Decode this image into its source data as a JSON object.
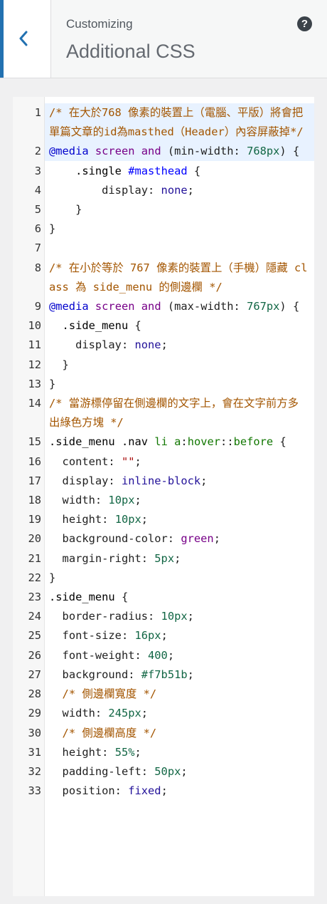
{
  "header": {
    "subtitle": "Customizing",
    "title": "Additional CSS",
    "back_label": "Back",
    "help_label": "?"
  },
  "editor": {
    "lines": [
      {
        "n": "1",
        "tokens": [
          [
            "cm",
            "/* 在大於768 像素的裝置上（電腦、平版）將會把單篇文章的id為masthed（Header）內容屏蔽掉*/"
          ]
        ]
      },
      {
        "n": "2",
        "tokens": [
          [
            "at",
            "@media"
          ],
          [
            "",
            " "
          ],
          [
            "kw",
            "screen"
          ],
          [
            "",
            " "
          ],
          [
            "kw",
            "and"
          ],
          [
            "",
            " (min-width: "
          ],
          [
            "num",
            "768px"
          ],
          [
            "",
            ") {"
          ]
        ]
      },
      {
        "n": "3",
        "tokens": [
          [
            "",
            "    "
          ],
          [
            "cls",
            ".single"
          ],
          [
            "",
            " "
          ],
          [
            "id",
            "#masthead"
          ],
          [
            "",
            " {"
          ]
        ]
      },
      {
        "n": "4",
        "tokens": [
          [
            "",
            "        display: "
          ],
          [
            "val",
            "none"
          ],
          [
            "",
            ";"
          ]
        ]
      },
      {
        "n": "5",
        "tokens": [
          [
            "",
            "    }"
          ]
        ]
      },
      {
        "n": "6",
        "tokens": [
          [
            "",
            "}"
          ]
        ]
      },
      {
        "n": "7",
        "tokens": [
          [
            "",
            " "
          ]
        ]
      },
      {
        "n": "8",
        "tokens": [
          [
            "cm",
            "/* 在小於等於 767 像素的裝置上（手機）隱藏 class 為 side_menu 的側邊欄 */"
          ]
        ]
      },
      {
        "n": "9",
        "tokens": [
          [
            "at",
            "@media"
          ],
          [
            "",
            " "
          ],
          [
            "kw",
            "screen"
          ],
          [
            "",
            " "
          ],
          [
            "kw",
            "and"
          ],
          [
            "",
            " (max-width: "
          ],
          [
            "num",
            "767px"
          ],
          [
            "",
            ") {"
          ]
        ]
      },
      {
        "n": "10",
        "tokens": [
          [
            "",
            "  "
          ],
          [
            "cls",
            ".side_menu"
          ],
          [
            "",
            " {"
          ]
        ]
      },
      {
        "n": "11",
        "tokens": [
          [
            "",
            "    display: "
          ],
          [
            "val",
            "none"
          ],
          [
            "",
            ";"
          ]
        ]
      },
      {
        "n": "12",
        "tokens": [
          [
            "",
            "  }"
          ]
        ]
      },
      {
        "n": "13",
        "tokens": [
          [
            "",
            "}"
          ]
        ]
      },
      {
        "n": "14",
        "tokens": [
          [
            "cm",
            "/* 當游標停留在側邊欄的文字上，會在文字前方多出綠色方塊 */"
          ]
        ]
      },
      {
        "n": "15",
        "tokens": [
          [
            "cls",
            ".side_menu"
          ],
          [
            "",
            " "
          ],
          [
            "cls",
            ".nav"
          ],
          [
            "",
            " "
          ],
          [
            "tag",
            "li"
          ],
          [
            "",
            " "
          ],
          [
            "tag",
            "a"
          ],
          [
            "",
            ":"
          ],
          [
            "tag",
            "hover"
          ],
          [
            "",
            "::"
          ],
          [
            "tag",
            "before"
          ],
          [
            "",
            " {"
          ]
        ]
      },
      {
        "n": "16",
        "tokens": [
          [
            "",
            "  content: "
          ],
          [
            "str",
            "\"\""
          ],
          [
            "",
            ";"
          ]
        ]
      },
      {
        "n": "17",
        "tokens": [
          [
            "",
            "  display: "
          ],
          [
            "val",
            "inline-block"
          ],
          [
            "",
            ";"
          ]
        ]
      },
      {
        "n": "18",
        "tokens": [
          [
            "",
            "  width: "
          ],
          [
            "num",
            "10px"
          ],
          [
            "",
            ";"
          ]
        ]
      },
      {
        "n": "19",
        "tokens": [
          [
            "",
            "  height: "
          ],
          [
            "num",
            "10px"
          ],
          [
            "",
            ";"
          ]
        ]
      },
      {
        "n": "20",
        "tokens": [
          [
            "",
            "  background-color: "
          ],
          [
            "vr",
            "green"
          ],
          [
            "",
            ";"
          ]
        ]
      },
      {
        "n": "21",
        "tokens": [
          [
            "",
            "  margin-right: "
          ],
          [
            "num",
            "5px"
          ],
          [
            "",
            ";"
          ]
        ]
      },
      {
        "n": "22",
        "tokens": [
          [
            "",
            "}"
          ]
        ]
      },
      {
        "n": "23",
        "tokens": [
          [
            "cls",
            ".side_menu"
          ],
          [
            "",
            " {"
          ]
        ]
      },
      {
        "n": "24",
        "tokens": [
          [
            "",
            "  border-radius: "
          ],
          [
            "num",
            "10px"
          ],
          [
            "",
            ";"
          ]
        ]
      },
      {
        "n": "25",
        "tokens": [
          [
            "",
            "  font-size: "
          ],
          [
            "num",
            "16px"
          ],
          [
            "",
            ";"
          ]
        ]
      },
      {
        "n": "26",
        "tokens": [
          [
            "",
            "  font-weight: "
          ],
          [
            "num",
            "400"
          ],
          [
            "",
            ";"
          ]
        ]
      },
      {
        "n": "27",
        "tokens": [
          [
            "",
            "  background: "
          ],
          [
            "num",
            "#f7b51b"
          ],
          [
            "",
            ";"
          ]
        ]
      },
      {
        "n": "28",
        "tokens": [
          [
            "",
            "  "
          ],
          [
            "cm",
            "/* 側邊欄寬度 */"
          ]
        ]
      },
      {
        "n": "29",
        "tokens": [
          [
            "",
            "  width: "
          ],
          [
            "num",
            "245px"
          ],
          [
            "",
            ";"
          ]
        ]
      },
      {
        "n": "30",
        "tokens": [
          [
            "",
            "  "
          ],
          [
            "cm",
            "/* 側邊欄高度 */"
          ]
        ]
      },
      {
        "n": "31",
        "tokens": [
          [
            "",
            "  height: "
          ],
          [
            "num",
            "55%"
          ],
          [
            "",
            ";"
          ]
        ]
      },
      {
        "n": "32",
        "tokens": [
          [
            "",
            "  padding-left: "
          ],
          [
            "num",
            "50px"
          ],
          [
            "",
            ";"
          ]
        ]
      },
      {
        "n": "33",
        "tokens": [
          [
            "",
            "  position: "
          ],
          [
            "val",
            "fixed"
          ],
          [
            "",
            ";"
          ]
        ]
      }
    ]
  }
}
